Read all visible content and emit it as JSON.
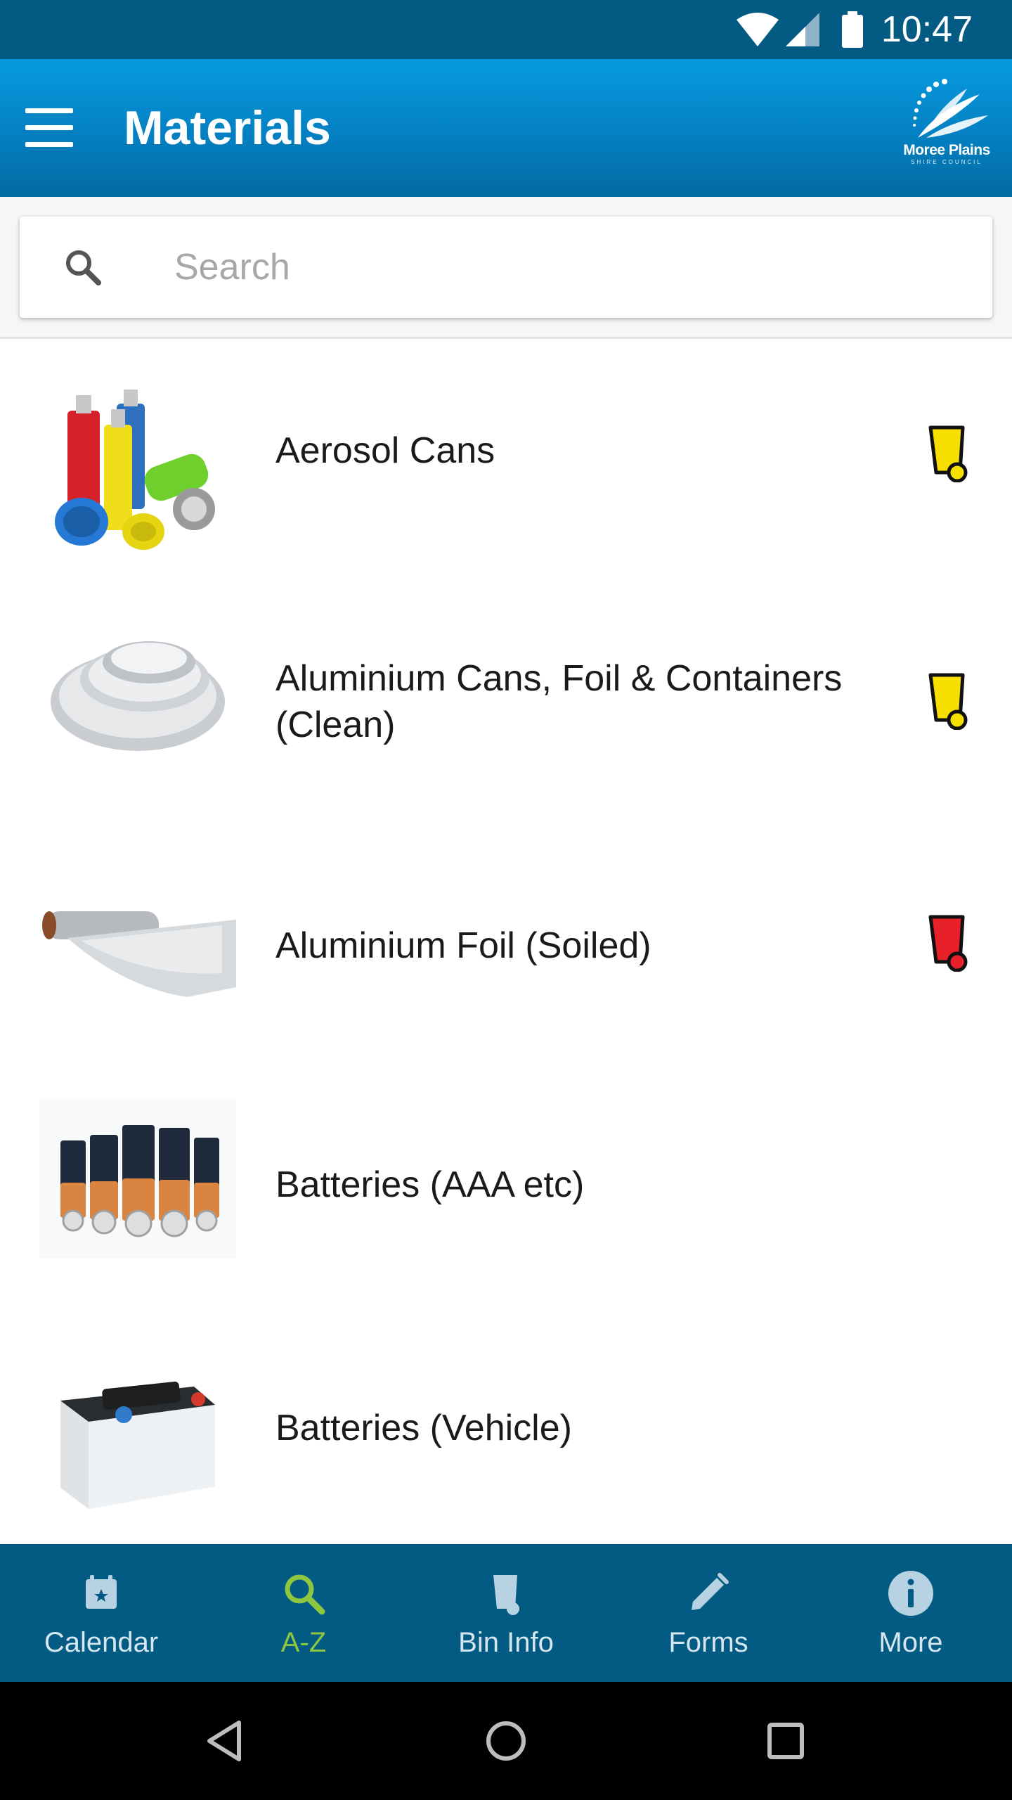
{
  "status_bar": {
    "time": "10:47"
  },
  "app_bar": {
    "title": "Materials",
    "logo_text": "Moree Plains",
    "logo_subtext": "SHIRE COUNCIL"
  },
  "search": {
    "placeholder": "Search",
    "value": ""
  },
  "materials": [
    {
      "label": "Aerosol Cans",
      "bin": "yellow"
    },
    {
      "label": "Aluminium Cans, Foil & Containers (Clean)",
      "bin": "yellow"
    },
    {
      "label": "Aluminium Foil (Soiled)",
      "bin": "red"
    },
    {
      "label": "Batteries (AAA etc)",
      "bin": "none"
    },
    {
      "label": "Batteries (Vehicle)",
      "bin": "none"
    }
  ],
  "bottom_nav": [
    {
      "label": "Calendar",
      "icon": "calendar-icon",
      "active": false
    },
    {
      "label": "A-Z",
      "icon": "search-icon",
      "active": true
    },
    {
      "label": "Bin Info",
      "icon": "bin-icon",
      "active": false
    },
    {
      "label": "Forms",
      "icon": "pencil-icon",
      "active": false
    },
    {
      "label": "More",
      "icon": "info-icon",
      "active": false
    }
  ],
  "colors": {
    "status_bar": "#035a82",
    "app_bar": "#0480c2",
    "nav_active": "#8dc63f",
    "bin_yellow": "#f7e000",
    "bin_red": "#e8202a"
  }
}
